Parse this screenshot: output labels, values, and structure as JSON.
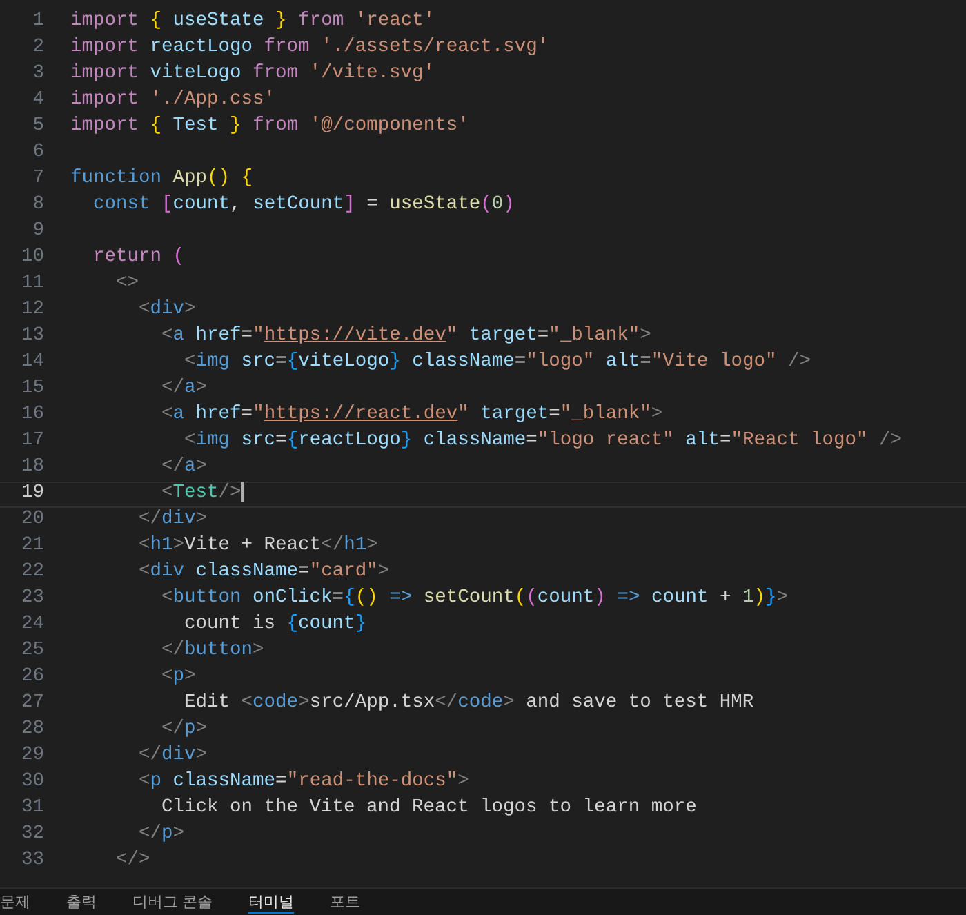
{
  "lines": [
    {
      "number": "1",
      "selected": false,
      "tokens": [
        {
          "text": "import",
          "kind": "keyword"
        },
        {
          "text": " {",
          "kind": "bracket1"
        },
        {
          "text": " useState ",
          "kind": "variable"
        },
        {
          "text": "}",
          "kind": "bracket1"
        },
        {
          "text": " from",
          "kind": "keyword"
        },
        {
          "text": " 'react'",
          "kind": "string"
        }
      ]
    },
    {
      "number": "2",
      "selected": false,
      "tokens": [
        {
          "text": "import",
          "kind": "keyword"
        },
        {
          "text": " reactLogo ",
          "kind": "variable"
        },
        {
          "text": "from",
          "kind": "keyword"
        },
        {
          "text": " './assets/react.svg'",
          "kind": "string"
        }
      ]
    },
    {
      "number": "3",
      "selected": false,
      "tokens": [
        {
          "text": "import",
          "kind": "keyword"
        },
        {
          "text": " viteLogo ",
          "kind": "variable"
        },
        {
          "text": "from",
          "kind": "keyword"
        },
        {
          "text": " '/vite.svg'",
          "kind": "string"
        }
      ]
    },
    {
      "number": "4",
      "selected": false,
      "tokens": [
        {
          "text": "import",
          "kind": "keyword"
        },
        {
          "text": " './App.css'",
          "kind": "string"
        }
      ]
    },
    {
      "number": "5",
      "selected": false,
      "tokens": [
        {
          "text": "import",
          "kind": "keyword"
        },
        {
          "text": " {",
          "kind": "bracket1"
        },
        {
          "text": " Test ",
          "kind": "variable"
        },
        {
          "text": "}",
          "kind": "bracket1"
        },
        {
          "text": " from",
          "kind": "keyword"
        },
        {
          "text": " '@/components'",
          "kind": "string"
        }
      ]
    },
    {
      "number": "6",
      "selected": false
    },
    {
      "number": "7",
      "selected": false,
      "tokens": [
        {
          "text": "function",
          "kind": "storage"
        },
        {
          "text": " App",
          "kind": "function"
        },
        {
          "text": "()",
          "kind": "bracket1"
        },
        {
          "text": " {",
          "kind": "bracket1"
        }
      ]
    },
    {
      "number": "8",
      "selected": false,
      "tokens": [
        {
          "text": "  const",
          "kind": "storage"
        },
        {
          "text": " [",
          "kind": "bracket2"
        },
        {
          "text": "count",
          "kind": "variable"
        },
        {
          "text": ", ",
          "kind": "plain"
        },
        {
          "text": "setCount",
          "kind": "variable"
        },
        {
          "text": "]",
          "kind": "bracket2"
        },
        {
          "text": " = ",
          "kind": "plain"
        },
        {
          "text": "useState",
          "kind": "function"
        },
        {
          "text": "(",
          "kind": "bracket2"
        },
        {
          "text": "0",
          "kind": "number"
        },
        {
          "text": ")",
          "kind": "bracket2"
        }
      ]
    },
    {
      "number": "9",
      "selected": false
    },
    {
      "number": "10",
      "selected": false,
      "tokens": [
        {
          "text": "  return",
          "kind": "keyword"
        },
        {
          "text": " (",
          "kind": "bracket2"
        }
      ]
    },
    {
      "number": "11",
      "selected": false,
      "tokens": [
        {
          "text": "    <>",
          "kind": "punct"
        }
      ]
    },
    {
      "number": "12",
      "selected": false,
      "tokens": [
        {
          "text": "      <",
          "kind": "punct"
        },
        {
          "text": "div",
          "kind": "tag"
        },
        {
          "text": ">",
          "kind": "punct"
        }
      ]
    },
    {
      "number": "13",
      "selected": false,
      "tokens": [
        {
          "text": "        <",
          "kind": "punct"
        },
        {
          "text": "a",
          "kind": "tag"
        },
        {
          "text": " href",
          "kind": "attr"
        },
        {
          "text": "=",
          "kind": "plain"
        },
        {
          "text": "\"",
          "kind": "string"
        },
        {
          "text": "https://vite.dev",
          "kind": "url"
        },
        {
          "text": "\"",
          "kind": "string"
        },
        {
          "text": " target",
          "kind": "attr"
        },
        {
          "text": "=",
          "kind": "plain"
        },
        {
          "text": "\"_blank\"",
          "kind": "string"
        },
        {
          "text": ">",
          "kind": "punct"
        }
      ]
    },
    {
      "number": "14",
      "selected": false,
      "tokens": [
        {
          "text": "          <",
          "kind": "punct"
        },
        {
          "text": "img",
          "kind": "tag"
        },
        {
          "text": " src",
          "kind": "attr"
        },
        {
          "text": "=",
          "kind": "plain"
        },
        {
          "text": "{",
          "kind": "bracket3"
        },
        {
          "text": "viteLogo",
          "kind": "variable"
        },
        {
          "text": "}",
          "kind": "bracket3"
        },
        {
          "text": " className",
          "kind": "attr"
        },
        {
          "text": "=",
          "kind": "plain"
        },
        {
          "text": "\"logo\"",
          "kind": "string"
        },
        {
          "text": " alt",
          "kind": "attr"
        },
        {
          "text": "=",
          "kind": "plain"
        },
        {
          "text": "\"Vite logo\"",
          "kind": "string"
        },
        {
          "text": " />",
          "kind": "punct"
        }
      ]
    },
    {
      "number": "15",
      "selected": false,
      "tokens": [
        {
          "text": "        </",
          "kind": "punct"
        },
        {
          "text": "a",
          "kind": "tag"
        },
        {
          "text": ">",
          "kind": "punct"
        }
      ]
    },
    {
      "number": "16",
      "selected": false,
      "tokens": [
        {
          "text": "        <",
          "kind": "punct"
        },
        {
          "text": "a",
          "kind": "tag"
        },
        {
          "text": " href",
          "kind": "attr"
        },
        {
          "text": "=",
          "kind": "plain"
        },
        {
          "text": "\"",
          "kind": "string"
        },
        {
          "text": "https://react.dev",
          "kind": "url"
        },
        {
          "text": "\"",
          "kind": "string"
        },
        {
          "text": " target",
          "kind": "attr"
        },
        {
          "text": "=",
          "kind": "plain"
        },
        {
          "text": "\"_blank\"",
          "kind": "string"
        },
        {
          "text": ">",
          "kind": "punct"
        }
      ]
    },
    {
      "number": "17",
      "selected": false,
      "tokens": [
        {
          "text": "          <",
          "kind": "punct"
        },
        {
          "text": "img",
          "kind": "tag"
        },
        {
          "text": " src",
          "kind": "attr"
        },
        {
          "text": "=",
          "kind": "plain"
        },
        {
          "text": "{",
          "kind": "bracket3"
        },
        {
          "text": "reactLogo",
          "kind": "variable"
        },
        {
          "text": "}",
          "kind": "bracket3"
        },
        {
          "text": " className",
          "kind": "attr"
        },
        {
          "text": "=",
          "kind": "plain"
        },
        {
          "text": "\"logo react\"",
          "kind": "string"
        },
        {
          "text": " alt",
          "kind": "attr"
        },
        {
          "text": "=",
          "kind": "plain"
        },
        {
          "text": "\"React logo\"",
          "kind": "string"
        },
        {
          "text": " />",
          "kind": "punct"
        }
      ]
    },
    {
      "number": "18",
      "selected": false,
      "tokens": [
        {
          "text": "        </",
          "kind": "punct"
        },
        {
          "text": "a",
          "kind": "tag"
        },
        {
          "text": ">",
          "kind": "punct"
        }
      ]
    },
    {
      "number": "19",
      "selected": true,
      "tokens": [
        {
          "text": "        <",
          "kind": "punct"
        },
        {
          "text": "Test",
          "kind": "component"
        },
        {
          "text": "/>",
          "kind": "punct"
        }
      ]
    },
    {
      "number": "20",
      "selected": false,
      "tokens": [
        {
          "text": "      </",
          "kind": "punct"
        },
        {
          "text": "div",
          "kind": "tag"
        },
        {
          "text": ">",
          "kind": "punct"
        }
      ]
    },
    {
      "number": "21",
      "selected": false,
      "tokens": [
        {
          "text": "      <",
          "kind": "punct"
        },
        {
          "text": "h1",
          "kind": "tag"
        },
        {
          "text": ">",
          "kind": "punct"
        },
        {
          "text": "Vite + React",
          "kind": "plain"
        },
        {
          "text": "</",
          "kind": "punct"
        },
        {
          "text": "h1",
          "kind": "tag"
        },
        {
          "text": ">",
          "kind": "punct"
        }
      ]
    },
    {
      "number": "22",
      "selected": false,
      "tokens": [
        {
          "text": "      <",
          "kind": "punct"
        },
        {
          "text": "div",
          "kind": "tag"
        },
        {
          "text": " className",
          "kind": "attr"
        },
        {
          "text": "=",
          "kind": "plain"
        },
        {
          "text": "\"card\"",
          "kind": "string"
        },
        {
          "text": ">",
          "kind": "punct"
        }
      ]
    },
    {
      "number": "23",
      "selected": false,
      "tokens": [
        {
          "text": "        <",
          "kind": "punct"
        },
        {
          "text": "button",
          "kind": "tag"
        },
        {
          "text": " onClick",
          "kind": "attr"
        },
        {
          "text": "=",
          "kind": "plain"
        },
        {
          "text": "{",
          "kind": "bracket3"
        },
        {
          "text": "()",
          "kind": "bracket1"
        },
        {
          "text": " => ",
          "kind": "storage"
        },
        {
          "text": "setCount",
          "kind": "function"
        },
        {
          "text": "(",
          "kind": "bracket1"
        },
        {
          "text": "(",
          "kind": "bracket2"
        },
        {
          "text": "count",
          "kind": "variable"
        },
        {
          "text": ")",
          "kind": "bracket2"
        },
        {
          "text": " => ",
          "kind": "storage"
        },
        {
          "text": "count",
          "kind": "variable"
        },
        {
          "text": " + ",
          "kind": "plain"
        },
        {
          "text": "1",
          "kind": "number"
        },
        {
          "text": ")",
          "kind": "bracket1"
        },
        {
          "text": "}",
          "kind": "bracket3"
        },
        {
          "text": ">",
          "kind": "punct"
        }
      ]
    },
    {
      "number": "24",
      "selected": false,
      "tokens": [
        {
          "text": "          count is ",
          "kind": "plain"
        },
        {
          "text": "{",
          "kind": "bracket3"
        },
        {
          "text": "count",
          "kind": "variable"
        },
        {
          "text": "}",
          "kind": "bracket3"
        }
      ]
    },
    {
      "number": "25",
      "selected": false,
      "tokens": [
        {
          "text": "        </",
          "kind": "punct"
        },
        {
          "text": "button",
          "kind": "tag"
        },
        {
          "text": ">",
          "kind": "punct"
        }
      ]
    },
    {
      "number": "26",
      "selected": false,
      "tokens": [
        {
          "text": "        <",
          "kind": "punct"
        },
        {
          "text": "p",
          "kind": "tag"
        },
        {
          "text": ">",
          "kind": "punct"
        }
      ]
    },
    {
      "number": "27",
      "selected": false,
      "tokens": [
        {
          "text": "          Edit ",
          "kind": "plain"
        },
        {
          "text": "<",
          "kind": "punct"
        },
        {
          "text": "code",
          "kind": "tag"
        },
        {
          "text": ">",
          "kind": "punct"
        },
        {
          "text": "src/App.tsx",
          "kind": "plain"
        },
        {
          "text": "</",
          "kind": "punct"
        },
        {
          "text": "code",
          "kind": "tag"
        },
        {
          "text": ">",
          "kind": "punct"
        },
        {
          "text": " and save to test HMR",
          "kind": "plain"
        }
      ]
    },
    {
      "number": "28",
      "selected": false,
      "tokens": [
        {
          "text": "        </",
          "kind": "punct"
        },
        {
          "text": "p",
          "kind": "tag"
        },
        {
          "text": ">",
          "kind": "punct"
        }
      ]
    },
    {
      "number": "29",
      "selected": false,
      "tokens": [
        {
          "text": "      </",
          "kind": "punct"
        },
        {
          "text": "div",
          "kind": "tag"
        },
        {
          "text": ">",
          "kind": "punct"
        }
      ]
    },
    {
      "number": "30",
      "selected": false,
      "tokens": [
        {
          "text": "      <",
          "kind": "punct"
        },
        {
          "text": "p",
          "kind": "tag"
        },
        {
          "text": " className",
          "kind": "attr"
        },
        {
          "text": "=",
          "kind": "plain"
        },
        {
          "text": "\"read-the-docs\"",
          "kind": "string"
        },
        {
          "text": ">",
          "kind": "punct"
        }
      ]
    },
    {
      "number": "31",
      "selected": false,
      "tokens": [
        {
          "text": "        Click on the Vite and React logos to learn more",
          "kind": "plain"
        }
      ]
    },
    {
      "number": "32",
      "selected": false,
      "tokens": [
        {
          "text": "      </",
          "kind": "punct"
        },
        {
          "text": "p",
          "kind": "tag"
        },
        {
          "text": ">",
          "kind": "punct"
        }
      ]
    },
    {
      "number": "33",
      "selected": false,
      "tokens": [
        {
          "text": "    </>",
          "kind": "punct"
        }
      ]
    }
  ],
  "panel_tabs": [
    {
      "label": "문제",
      "selected": false
    },
    {
      "label": "출력",
      "selected": false
    },
    {
      "label": "디버그 콘솔",
      "selected": false
    },
    {
      "label": "터미널",
      "selected": true
    },
    {
      "label": "포트",
      "selected": false
    }
  ]
}
